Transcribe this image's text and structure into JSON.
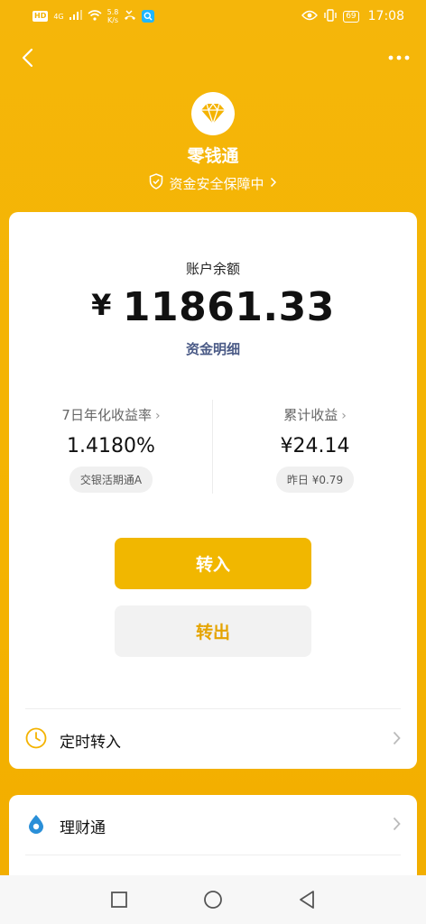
{
  "colors": {
    "brand": "#f4b300",
    "button_primary": "#f1b700",
    "link_text": "#4a5a86",
    "card_bg": "#ffffff"
  },
  "status_bar": {
    "signal_labels": [
      "HD",
      "4G"
    ],
    "net_speed_value": "5.8",
    "net_speed_unit": "K/s",
    "battery": "69",
    "time": "17:08",
    "icons": [
      "hd-icon",
      "signal-icon",
      "wifi-icon",
      "missed-call-icon",
      "search-app-icon",
      "eye-icon",
      "vibrate-icon",
      "battery-icon"
    ]
  },
  "app_bar": {
    "back_icon": "back-arrow-icon",
    "more_icon": "more-dots-icon"
  },
  "header": {
    "logo_icon": "diamond-icon",
    "title": "零钱通",
    "safety_text": "资金安全保障中",
    "safety_icon": "shield-check-icon"
  },
  "balance": {
    "label": "账户余额",
    "currency": "¥",
    "amount": "11861.33",
    "detail_link": "资金明细"
  },
  "stats": {
    "yield": {
      "title": "7日年化收益率",
      "value": "1.4180%",
      "tag": "交银活期通A"
    },
    "earnings": {
      "title": "累计收益",
      "value": "¥24.14",
      "tag": "昨日 ¥0.79"
    }
  },
  "actions": {
    "deposit_label": "转入",
    "withdraw_label": "转出"
  },
  "list": {
    "scheduled_label": "定时转入",
    "scheduled_icon": "clock-icon",
    "wealth_label": "理财通",
    "wealth_icon": "wealth-drop-icon"
  },
  "nav": {
    "icons": [
      "recent-apps-icon",
      "home-icon",
      "back-icon"
    ]
  }
}
